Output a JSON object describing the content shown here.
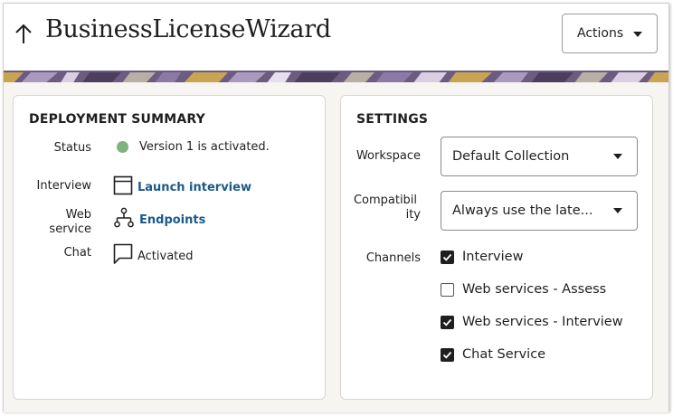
{
  "header": {
    "title": "BusinessLicenseWizard",
    "actions_label": "Actions"
  },
  "deployment": {
    "title": "DEPLOYMENT SUMMARY",
    "status_label": "Status",
    "status_value": "Version 1 is activated.",
    "interview_label": "Interview",
    "interview_link": "Launch interview",
    "webservice_label_1": "Web",
    "webservice_label_2": "service",
    "webservice_link": "Endpoints",
    "chat_label": "Chat",
    "chat_value": "Activated"
  },
  "settings": {
    "title": "SETTINGS",
    "workspace_label": "Workspace",
    "workspace_value": "Default Collection",
    "compat_label_1": "Compatibil",
    "compat_label_2": "ity",
    "compat_value": "Always use the late...",
    "channels_label": "Channels",
    "channels": [
      {
        "label": "Interview",
        "checked": true
      },
      {
        "label": "Web services - Assess",
        "checked": false
      },
      {
        "label": "Web services - Interview",
        "checked": true
      },
      {
        "label": "Chat Service",
        "checked": true
      }
    ]
  },
  "colors": {
    "link": "#1a5a8a",
    "status_ok": "#7fb37e",
    "banner_purple": "#6c5c80"
  }
}
